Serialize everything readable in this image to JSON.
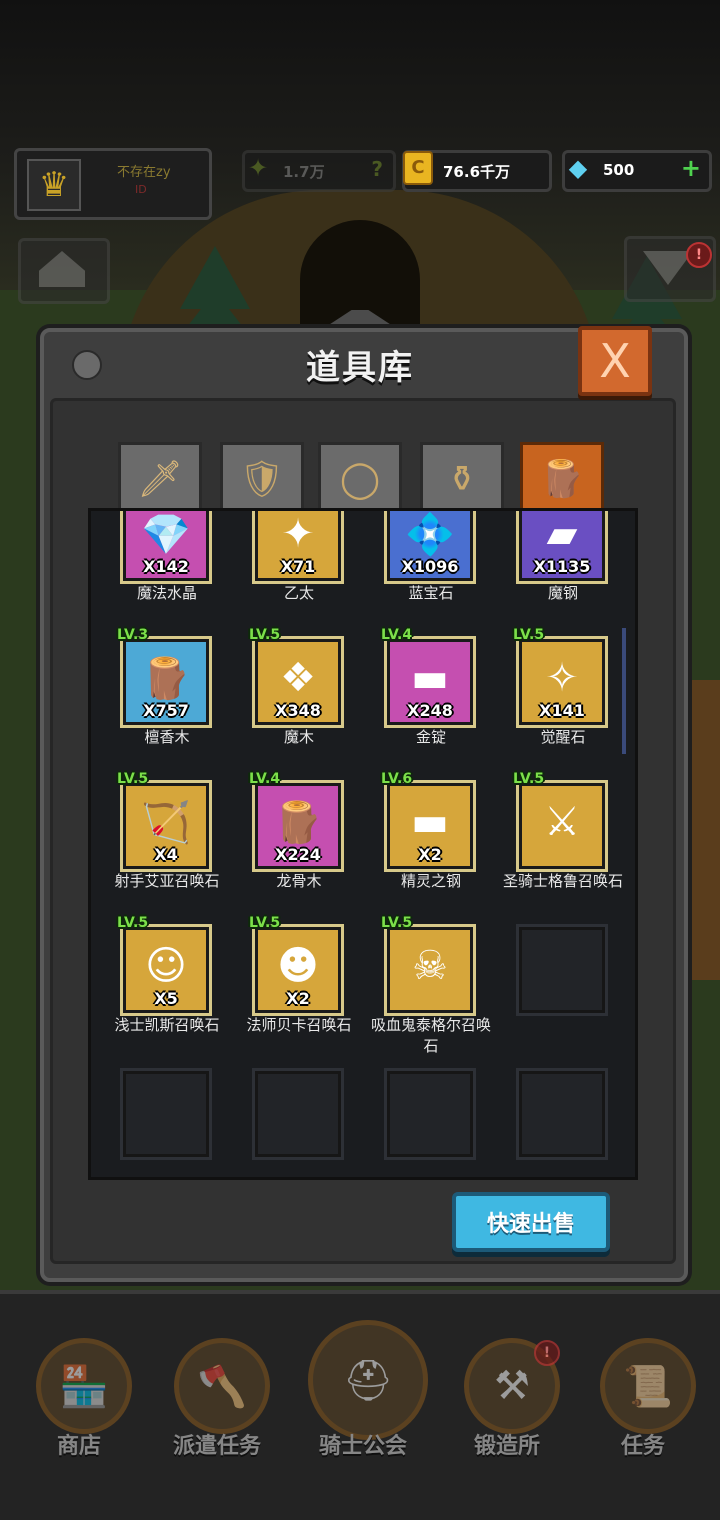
{
  "header": {
    "player_name": "不存在zy",
    "player_tag": "ID",
    "power_value": "1.7万",
    "gold_value": "76.6千万",
    "gem_value": "500",
    "help_label": "?",
    "plus_label": "+"
  },
  "panel": {
    "title": "道具库",
    "close_label": "X"
  },
  "tabs": [
    {
      "name": "weapon",
      "icon": "sword-icon",
      "active": false
    },
    {
      "name": "armor",
      "icon": "armor-icon",
      "active": false
    },
    {
      "name": "ring",
      "icon": "ring-icon",
      "active": false
    },
    {
      "name": "potion",
      "icon": "potion-icon",
      "active": false
    },
    {
      "name": "material",
      "icon": "log-icon",
      "active": true
    }
  ],
  "items": [
    {
      "name": "魔法水晶",
      "qty": "X142",
      "level": "",
      "icon": "crystal-icon",
      "bg": "pink"
    },
    {
      "name": "乙太",
      "qty": "X71",
      "level": "",
      "icon": "ether-icon",
      "bg": "gold"
    },
    {
      "name": "蓝宝石",
      "qty": "X1096",
      "level": "",
      "icon": "sapphire-icon",
      "bg": "blue"
    },
    {
      "name": "魔钢",
      "qty": "X1135",
      "level": "",
      "icon": "magic-steel-icon",
      "bg": "purple"
    },
    {
      "name": "檀香木",
      "qty": "X757",
      "level": "LV.3",
      "icon": "sandalwood-icon",
      "bg": "sky"
    },
    {
      "name": "魔木",
      "qty": "X348",
      "level": "LV.5",
      "icon": "magic-wood-icon",
      "bg": "gold"
    },
    {
      "name": "金锭",
      "qty": "X248",
      "level": "LV.4",
      "icon": "gold-ingot-icon",
      "bg": "pink"
    },
    {
      "name": "觉醒石",
      "qty": "X141",
      "level": "LV.5",
      "icon": "awakening-stone-icon",
      "bg": "gold"
    },
    {
      "name": "射手艾亚召唤石",
      "qty": "X4",
      "level": "LV.5",
      "icon": "archer-portrait-icon",
      "bg": "gold"
    },
    {
      "name": "龙骨木",
      "qty": "X224",
      "level": "LV.4",
      "icon": "dragonbone-wood-icon",
      "bg": "pink"
    },
    {
      "name": "精灵之钢",
      "qty": "X2",
      "level": "LV.6",
      "icon": "elf-steel-icon",
      "bg": "gold"
    },
    {
      "name": "圣骑士格鲁召唤石",
      "qty": "",
      "level": "LV.5",
      "icon": "paladin-portrait-icon",
      "bg": "gold"
    },
    {
      "name": "浅士凯斯召唤石",
      "qty": "X5",
      "level": "LV.5",
      "icon": "warrior-portrait-icon",
      "bg": "gold"
    },
    {
      "name": "法师贝卡召唤石",
      "qty": "X2",
      "level": "LV.5",
      "icon": "mage-portrait-icon",
      "bg": "gold"
    },
    {
      "name": "吸血鬼泰格尔召唤石",
      "qty": "",
      "level": "LV.5",
      "icon": "vampire-portrait-icon",
      "bg": "gold"
    }
  ],
  "quick_sell_label": "快速出售",
  "bottom_nav": [
    {
      "label": "商店",
      "icon": "shop-icon"
    },
    {
      "label": "派遣任务",
      "icon": "dispatch-icon"
    },
    {
      "label": "骑士公会",
      "icon": "knight-helmet-icon"
    },
    {
      "label": "锻造所",
      "icon": "forge-icon"
    },
    {
      "label": "任务",
      "icon": "quest-icon"
    }
  ],
  "badges": {
    "right_button": "!",
    "forge": "!"
  },
  "colors": {
    "panel": "#3e3e3e",
    "active_tab": "#c8641f",
    "quick_sell": "#3fb8e2",
    "level_text": "#7ce04a"
  }
}
